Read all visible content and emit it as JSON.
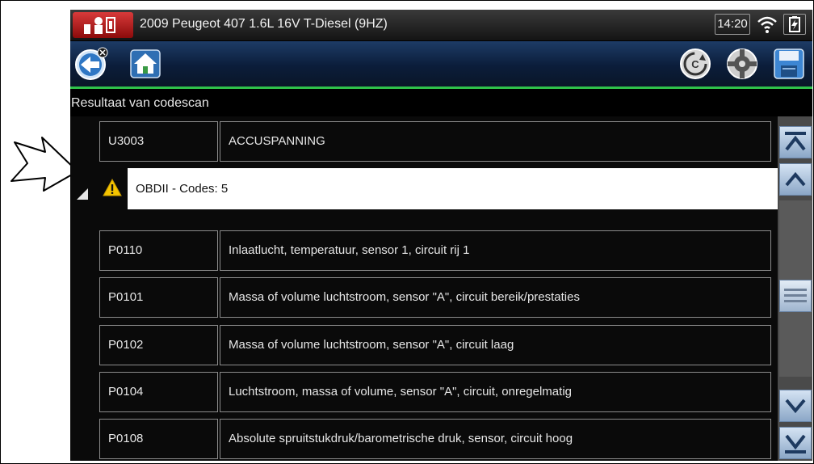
{
  "status": {
    "vehicle_title": "2009 Peugeot 407 1.6L 16V T-Diesel  (9HZ)",
    "time": "14:20"
  },
  "toolbar": {
    "back_icon": "back-arrow-icon",
    "home_icon": "home-icon",
    "clear_icon": "clear-codes-icon",
    "shortcut_icon": "shortcut-icon",
    "save_icon": "save-icon"
  },
  "screen_title": "Resultaat van codescan",
  "top_row": {
    "code": "U3003",
    "description": "ACCUSPANNING"
  },
  "group": {
    "label": "OBDII - Codes: 5",
    "icon": "warning-icon"
  },
  "codes": [
    {
      "code": "P0110",
      "description": "Inlaatlucht, temperatuur, sensor 1, circuit rij 1"
    },
    {
      "code": "P0101",
      "description": "Massa of volume luchtstroom, sensor \"A\", circuit bereik/prestaties"
    },
    {
      "code": "P0102",
      "description": "Massa of volume luchtstroom, sensor \"A\", circuit laag"
    },
    {
      "code": "P0104",
      "description": "Luchtstroom, massa of volume, sensor \"A\", circuit, onregelmatig"
    },
    {
      "code": "P0108",
      "description": "Absolute spruitstukdruk/barometrische druk, sensor, circuit hoog"
    }
  ],
  "colors": {
    "accent_green": "#2fc24a",
    "toolbar_blue": "#0b1d3a",
    "warning_yellow": "#f5c400"
  }
}
